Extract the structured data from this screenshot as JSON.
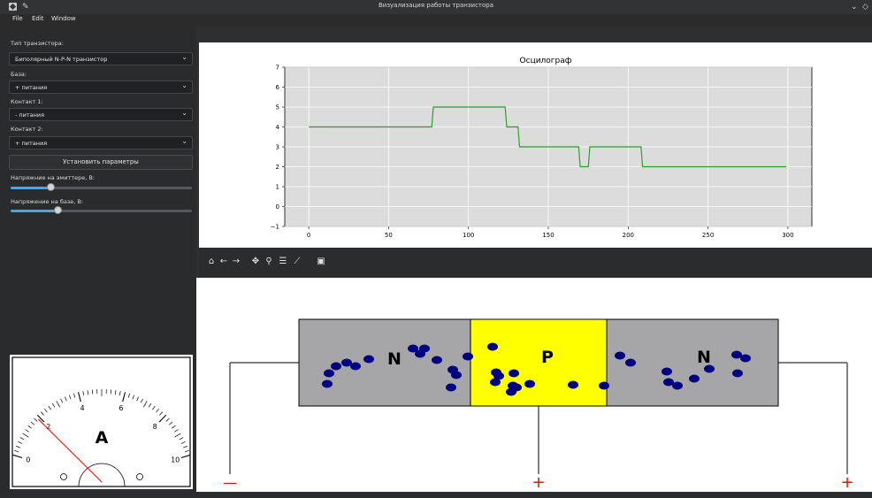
{
  "window": {
    "title": "Визуализация работы транзистора"
  },
  "menu": {
    "items": [
      "File",
      "Edit",
      "Window"
    ]
  },
  "controls": {
    "transistor_type_label": "Тип транзистора:",
    "transistor_type_value": "Биполярный N-P-N транзистор",
    "base_label": "База:",
    "base_value": "+ питания",
    "contact1_label": "Контакт 1:",
    "contact1_value": "- питания",
    "contact2_label": "Контакт 2:",
    "contact2_value": "+ питания",
    "apply_button": "Установить параметры",
    "emitter_voltage_label": "Напряжние на эмиттере, В:",
    "emitter_voltage_fraction": 0.22,
    "base_voltage_label": "Напряжение на базе, В:",
    "base_voltage_fraction": 0.26
  },
  "ammeter": {
    "letter": "A",
    "scale_labels": [
      "0",
      "2",
      "4",
      "6",
      "8",
      "10"
    ],
    "needle_value": 1.9
  },
  "chart_data": {
    "type": "line",
    "title": "Осцилограф",
    "xlim": [
      -15,
      315
    ],
    "ylim": [
      -1,
      7
    ],
    "xticks": [
      "0",
      "50",
      "100",
      "150",
      "200",
      "250",
      "300"
    ],
    "yticks": [
      "−1",
      "0",
      "1",
      "2",
      "3",
      "4",
      "5",
      "6",
      "7"
    ],
    "grid": true,
    "line_color": "#2ca02c",
    "x": [
      0,
      77,
      78,
      123,
      124,
      131,
      132,
      169,
      170,
      175,
      176,
      208,
      209,
      299
    ],
    "y": [
      4,
      4,
      5,
      5,
      4,
      4,
      3,
      3,
      2,
      2,
      3,
      3,
      2,
      2
    ]
  },
  "toolbar": {
    "icons": [
      "home-icon",
      "back-icon",
      "forward-icon",
      "pan-icon",
      "zoom-icon",
      "configure-icon",
      "edit-axes-icon",
      "save-icon"
    ]
  },
  "diagram": {
    "left_region": "N",
    "middle_region": "P",
    "right_region": "N",
    "left_terminal_sign": "—",
    "middle_terminal_sign": "+",
    "right_terminal_sign": "+",
    "n_color": "#a6a6a9",
    "p_color": "#ffff00",
    "carrier_color": "#000080",
    "sign_color": "#ff0000"
  }
}
